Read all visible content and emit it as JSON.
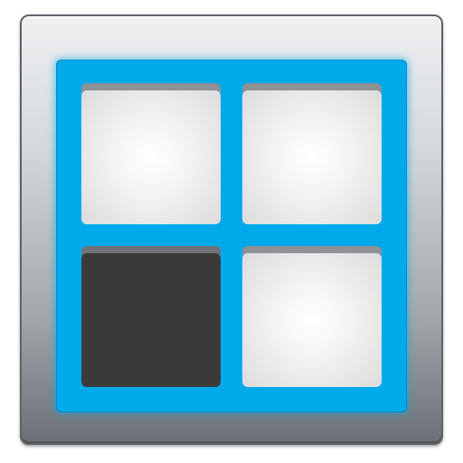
{
  "icon": {
    "name": "window-grid-icon",
    "colors": {
      "bezel_light": "#eef0f2",
      "bezel_dark": "#5f6469",
      "screen_blue": "#00a9ea",
      "tile_light": "#f3f3f3",
      "tile_dark": "#3c3a39"
    },
    "tiles": [
      {
        "name": "top-left",
        "state": "light"
      },
      {
        "name": "top-right",
        "state": "light"
      },
      {
        "name": "bottom-left",
        "state": "dark"
      },
      {
        "name": "bottom-right",
        "state": "light"
      }
    ]
  }
}
